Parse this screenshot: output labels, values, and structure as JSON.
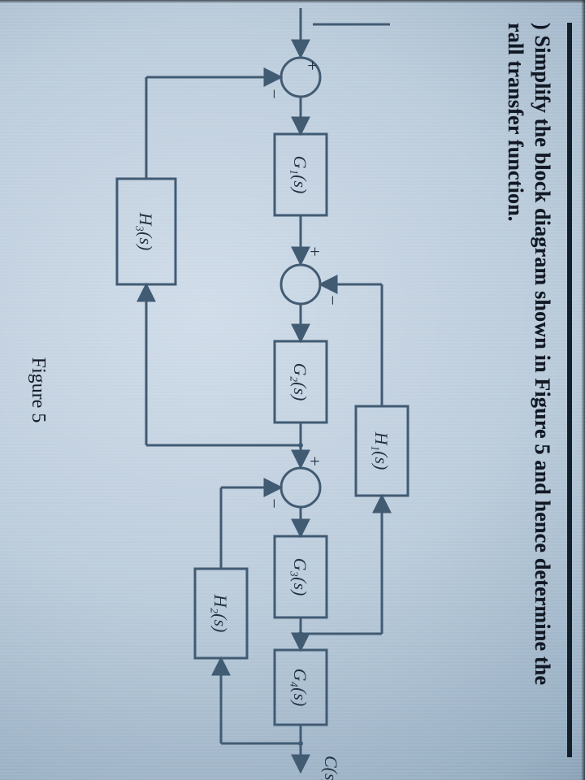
{
  "question": {
    "line1": ") Simplify the block diagram shown in Figure 5 and hence determine the",
    "line2": "rall transfer function."
  },
  "diagram": {
    "input_label": "",
    "output_label": "C(s)",
    "blocks": {
      "G1": "G₁(s)",
      "G2": "G₂(s)",
      "G3": "G₃(s)",
      "G4": "G₄(s)",
      "H1": "H₁(s)",
      "H2": "H₂(s)",
      "H3": "H₃(s)"
    },
    "summing": {
      "j1": {
        "left": "+",
        "bottom": "−"
      },
      "j2": {
        "left": "+",
        "top": "−"
      },
      "j3": {
        "left": "+",
        "bottom": "−"
      }
    },
    "figure_caption": "Figure 5"
  },
  "chart_data": {
    "type": "block_diagram",
    "nodes": [
      {
        "id": "in",
        "kind": "port",
        "label": ""
      },
      {
        "id": "s1",
        "kind": "sum",
        "inputs": {
          "left": "+",
          "bottom": "-"
        }
      },
      {
        "id": "G1",
        "kind": "block",
        "label": "G1(s)"
      },
      {
        "id": "s2",
        "kind": "sum",
        "inputs": {
          "left": "+",
          "top": "-"
        }
      },
      {
        "id": "G2",
        "kind": "block",
        "label": "G2(s)"
      },
      {
        "id": "s3",
        "kind": "sum",
        "inputs": {
          "left": "+",
          "bottom": "-"
        }
      },
      {
        "id": "G3",
        "kind": "block",
        "label": "G3(s)"
      },
      {
        "id": "G4",
        "kind": "block",
        "label": "G4(s)"
      },
      {
        "id": "H1",
        "kind": "block",
        "label": "H1(s)"
      },
      {
        "id": "H2",
        "kind": "block",
        "label": "H2(s)"
      },
      {
        "id": "H3",
        "kind": "block",
        "label": "H3(s)"
      },
      {
        "id": "out",
        "kind": "port",
        "label": "C(s)"
      }
    ],
    "edges": [
      {
        "from": "in",
        "to": "s1"
      },
      {
        "from": "s1",
        "to": "G1"
      },
      {
        "from": "G1",
        "to": "s2"
      },
      {
        "from": "s2",
        "to": "G2"
      },
      {
        "from": "G2",
        "to": "s3"
      },
      {
        "from": "s3",
        "to": "G3"
      },
      {
        "from": "G3",
        "to": "G4"
      },
      {
        "from": "G4",
        "to": "out"
      },
      {
        "from": "G3_out_tap",
        "to": "H1",
        "note": "pickoff after G3"
      },
      {
        "from": "H1",
        "to": "s2",
        "polarity": "-"
      },
      {
        "from": "G4_out_tap",
        "to": "H2",
        "note": "pickoff after G4"
      },
      {
        "from": "H2",
        "to": "s3",
        "polarity": "-"
      },
      {
        "from": "G2_out_tap",
        "to": "H3",
        "note": "pickoff after G2"
      },
      {
        "from": "H3",
        "to": "s1",
        "polarity": "-"
      }
    ]
  }
}
